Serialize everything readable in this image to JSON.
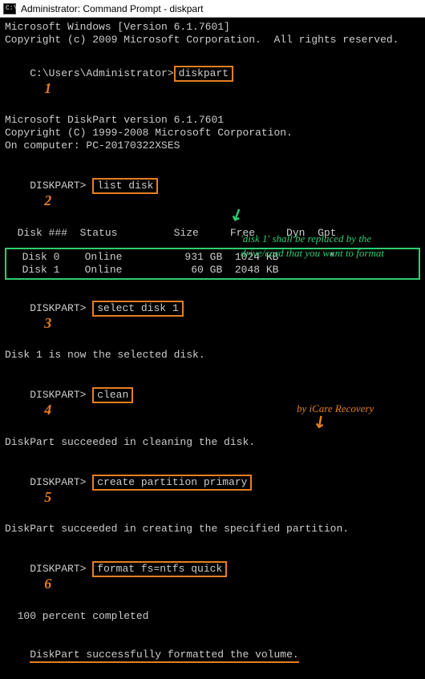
{
  "titlebar": {
    "icon_glyph": "C:\\",
    "text": "Administrator: Command Prompt - diskpart"
  },
  "header": {
    "line1": "Microsoft Windows [Version 6.1.7601]",
    "line2": "Copyright (c) 2009 Microsoft Corporation.  All rights reserved."
  },
  "prompt1": {
    "path": "C:\\Users\\Administrator>",
    "cmd": "diskpart",
    "step": "1"
  },
  "diskpart_header": {
    "line1": "Microsoft DiskPart version 6.1.7601",
    "line2": "Copyright (C) 1999-2008 Microsoft Corporation.",
    "line3": "On computer: PC-20170322XSES"
  },
  "prompt2": {
    "path": "DISKPART> ",
    "cmd": "list disk",
    "step": "2"
  },
  "table": {
    "header": "  Disk ###  Status         Size     Free     Dyn  Gpt",
    "divider": "  --------  -------------  -------  -------  ---  ---",
    "row0": "  Disk 0    Online          931 GB  1024 KB        *",
    "row1": "  Disk 1    Online           60 GB  2048 KB"
  },
  "prompt3": {
    "path": "DISKPART> ",
    "cmd": "select disk 1",
    "step": "3"
  },
  "note_green": {
    "arrow": "↙",
    "line1": "'disk 1' shall be replaced by the",
    "line2": "drive/card that you want to format"
  },
  "result3": "Disk 1 is now the selected disk.",
  "prompt4": {
    "path": "DISKPART> ",
    "cmd": "clean",
    "step": "4"
  },
  "result4": "DiskPart succeeded in cleaning the disk.",
  "prompt5": {
    "path": "DISKPART> ",
    "cmd": "create partition primary",
    "step": "5"
  },
  "result5": "DiskPart succeeded in creating the specified partition.",
  "prompt6": {
    "path": "DISKPART> ",
    "cmd": "format fs=ntfs quick",
    "step": "6"
  },
  "progress": "  100 percent completed",
  "credit": {
    "text": "by iCare Recovery",
    "arrow": "↙"
  },
  "final": "DiskPart successfully formatted the volume."
}
